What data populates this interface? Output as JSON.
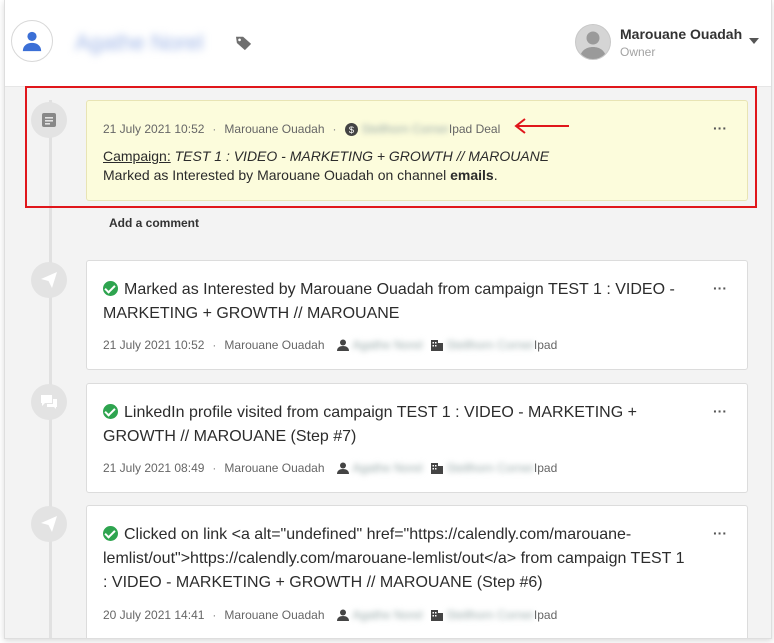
{
  "header": {
    "contact_name": "Agathe Norel",
    "owner_name": "Marouane Ouadah",
    "owner_role": "Owner"
  },
  "note": {
    "date": "21 July 2021 10:52",
    "author": "Marouane Ouadah",
    "deal_blur": "Stellhorn Corner",
    "deal_label": "Ipad Deal",
    "campaign_label": "Campaign:",
    "campaign_name": "TEST 1 : VIDEO - MARKETING + GROWTH // MAROUANE",
    "body_prefix": "Marked as Interested by Marouane Ouadah on channel ",
    "body_bold": "emails",
    "body_suffix": ".",
    "add_comment": "Add a comment"
  },
  "activities": [
    {
      "title": "Marked as Interested by Marouane Ouadah from campaign TEST 1 : VIDEO - MARKETING + GROWTH // MAROUANE",
      "date": "21 July 2021 10:52",
      "author": "Marouane Ouadah",
      "contact_blur": "Agathe Norel",
      "company_blur": "Stellhorn Corner",
      "company_suffix": "Ipad"
    },
    {
      "title": "LinkedIn profile visited from campaign TEST 1 : VIDEO - MARKETING + GROWTH // MAROUANE (Step #7)",
      "date": "21 July 2021 08:49",
      "author": "Marouane Ouadah",
      "contact_blur": "Agathe Norel",
      "company_blur": "Stellhorn Corner",
      "company_suffix": "Ipad"
    },
    {
      "title": "Clicked on link <a alt=\"undefined\" href=\"https://calendly.com/marouane-lemlist/out\">https://calendly.com/marouane-lemlist/out</a> from campaign TEST 1 : VIDEO - MARKETING + GROWTH // MAROUANE (Step #6)",
      "date": "20 July 2021 14:41",
      "author": "Marouane Ouadah",
      "contact_blur": "Agathe Norel",
      "company_blur": "Stellhorn Corner",
      "company_suffix": "Ipad"
    }
  ],
  "icons": {
    "note": "note-icon",
    "send": "send-icon",
    "chat": "chat-icon",
    "check": "check-icon",
    "person": "person-icon",
    "building": "building-icon",
    "dollar": "dollar-icon",
    "tag": "tag-icon",
    "more": "more-icon"
  },
  "colors": {
    "highlight": "#e0161b",
    "check": "#2ea44f",
    "note_bg": "#fcfcdc",
    "contact_avatar": "#3b6fd6"
  },
  "more_label": "···"
}
